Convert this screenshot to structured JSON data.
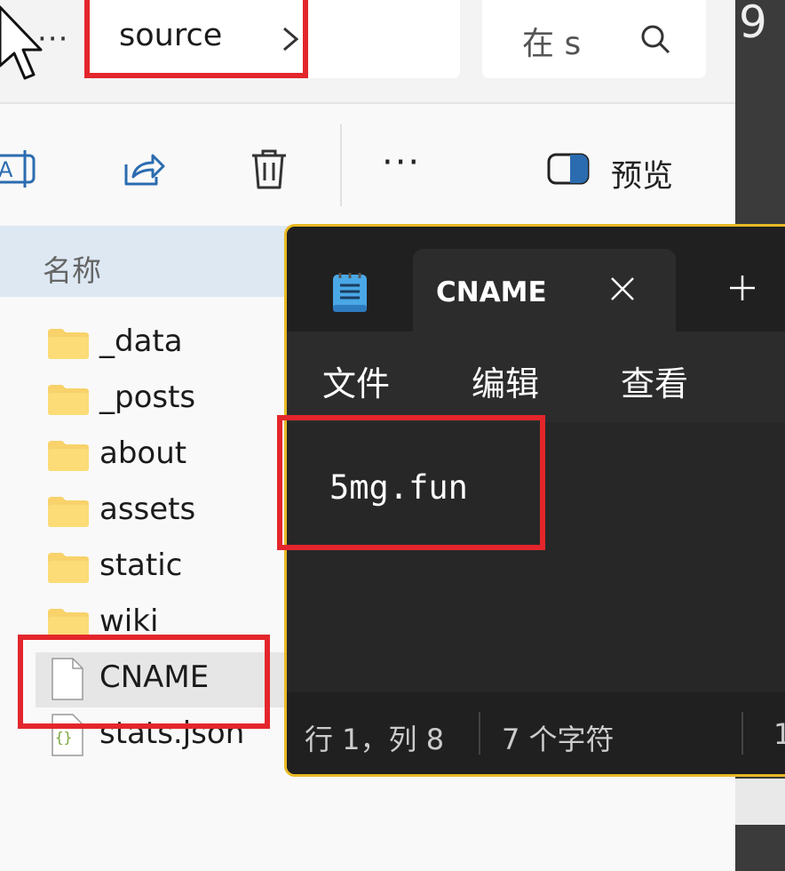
{
  "explorer": {
    "more_label": "···",
    "address": {
      "text": "source",
      "chevron": "chevron-right-icon"
    },
    "search": {
      "placeholder": "在 s",
      "icon": "search-icon"
    },
    "toolbar": {
      "icons": [
        "rename-icon",
        "share-icon",
        "delete-icon"
      ],
      "more_label": "···",
      "preview_icon": "preview-pane-icon",
      "preview_label": "预览"
    },
    "column_header": "名称",
    "items": [
      {
        "name": "_data",
        "type": "folder"
      },
      {
        "name": "_posts",
        "type": "folder"
      },
      {
        "name": "about",
        "type": "folder"
      },
      {
        "name": "assets",
        "type": "folder"
      },
      {
        "name": "static",
        "type": "folder"
      },
      {
        "name": "wiki",
        "type": "folder"
      },
      {
        "name": "CNAME",
        "type": "file",
        "selected": true
      },
      {
        "name": "stats.json",
        "type": "json"
      }
    ]
  },
  "notepad": {
    "app_icon": "notepad-icon",
    "tab_title": "CNAME",
    "menu": [
      "文件",
      "编辑",
      "查看"
    ],
    "content": "5mg.fun",
    "status": {
      "position": "行 1，列 8",
      "chars": "7 个字符",
      "extra": "1"
    }
  },
  "right_edge": {
    "text": "9"
  },
  "colors": {
    "highlight": "#e3262c",
    "folder": "#f8d26a",
    "selected_row": "#e6e6e6",
    "notepad_border": "#e8b923"
  }
}
